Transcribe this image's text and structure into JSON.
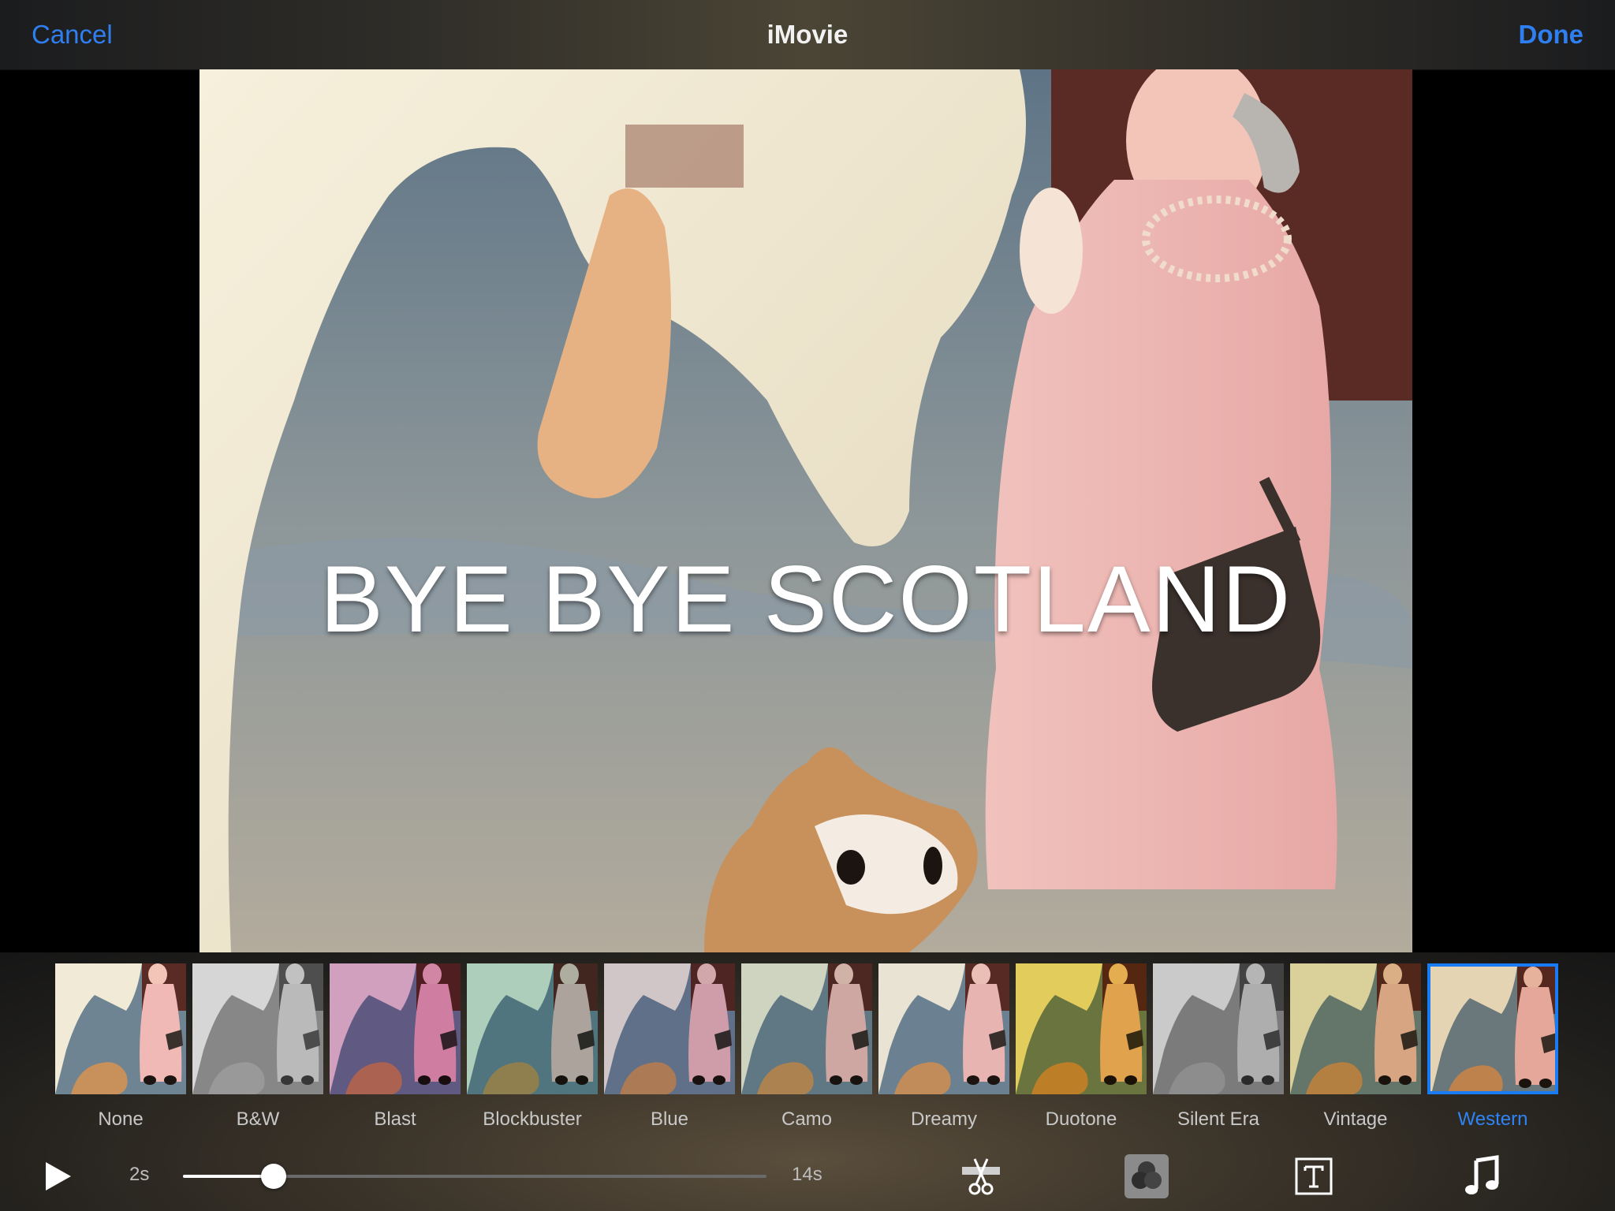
{
  "nav": {
    "cancel": "Cancel",
    "title": "iMovie",
    "done": "Done"
  },
  "viewer": {
    "title_overlay": "BYE BYE SCOTLAND"
  },
  "filters": [
    {
      "label": "None",
      "tint": "#ffffff",
      "blend": 0
    },
    {
      "label": "B&W",
      "tint": "#9a9a9a",
      "blend": 1
    },
    {
      "label": "Blast",
      "tint": "#b04ac0",
      "blend": 0.45
    },
    {
      "label": "Blockbuster",
      "tint": "#2fa8a0",
      "blend": 0.35
    },
    {
      "label": "Blue",
      "tint": "#9a8ed0",
      "blend": 0.35
    },
    {
      "label": "Camo",
      "tint": "#6fa09a",
      "blend": 0.25
    },
    {
      "label": "Dreamy",
      "tint": "#e8eef4",
      "blend": 0.4
    },
    {
      "label": "Duotone",
      "tint": "#e8d020",
      "blend": 0.65
    },
    {
      "label": "Silent Era",
      "tint": "#6a6a6a",
      "blend": 1
    },
    {
      "label": "Vintage",
      "tint": "#c8c060",
      "blend": 0.45
    },
    {
      "label": "Western",
      "tint": "#d0a060",
      "blend": 0.25
    }
  ],
  "selected_filter": "Western",
  "timeline": {
    "start_label": "2s",
    "end_label": "14s",
    "position": 0.155
  },
  "toolbar": {
    "play": "play-icon",
    "trim": "scissors-icon",
    "filters": "filters-icon",
    "text": "text-icon",
    "audio": "music-note-icon"
  }
}
